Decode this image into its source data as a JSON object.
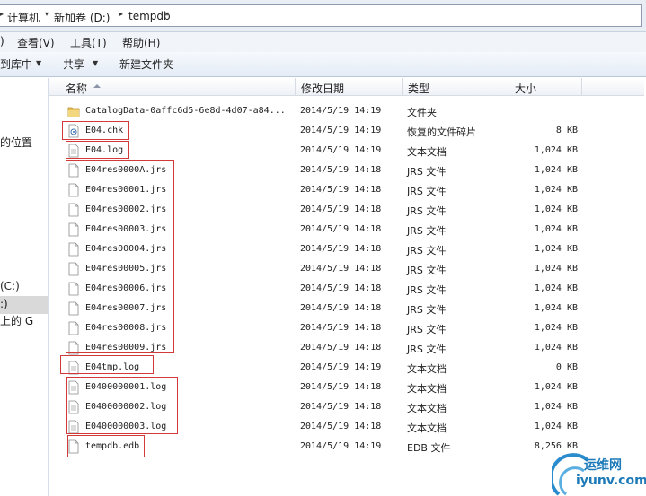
{
  "address": {
    "crumbs": [
      "计算机",
      "新加卷 (D:)",
      "tempdb"
    ]
  },
  "menubar": {
    "items": [
      "查看(V)",
      "工具(T)",
      "帮助(H)"
    ],
    "partial_left": ")"
  },
  "toolbar": {
    "library": "到库中",
    "share": "共享",
    "new_folder": "新建文件夹"
  },
  "nav": {
    "items": [
      "的位置",
      "(C:)",
      ":)",
      "上的 G"
    ]
  },
  "columns": {
    "name": "名称",
    "date": "修改日期",
    "type": "类型",
    "size": "大小"
  },
  "files": [
    {
      "name": "CatalogData-0affc6d5-6e8d-4d07-a84...",
      "date": "2014/5/19 14:19",
      "type": "文件夹",
      "size": "",
      "icon": "folder-icon"
    },
    {
      "name": "E04.chk",
      "date": "2014/5/19 14:19",
      "type": "恢复的文件碎片",
      "size": "8 KB",
      "icon": "chk-file-icon"
    },
    {
      "name": "E04.log",
      "date": "2014/5/19 14:19",
      "type": "文本文档",
      "size": "1,024 KB",
      "icon": "text-file-icon"
    },
    {
      "name": "E04res0000A.jrs",
      "date": "2014/5/19 14:18",
      "type": "JRS 文件",
      "size": "1,024 KB",
      "icon": "file-icon"
    },
    {
      "name": "E04res00001.jrs",
      "date": "2014/5/19 14:18",
      "type": "JRS 文件",
      "size": "1,024 KB",
      "icon": "file-icon"
    },
    {
      "name": "E04res00002.jrs",
      "date": "2014/5/19 14:18",
      "type": "JRS 文件",
      "size": "1,024 KB",
      "icon": "file-icon"
    },
    {
      "name": "E04res00003.jrs",
      "date": "2014/5/19 14:18",
      "type": "JRS 文件",
      "size": "1,024 KB",
      "icon": "file-icon"
    },
    {
      "name": "E04res00004.jrs",
      "date": "2014/5/19 14:18",
      "type": "JRS 文件",
      "size": "1,024 KB",
      "icon": "file-icon"
    },
    {
      "name": "E04res00005.jrs",
      "date": "2014/5/19 14:18",
      "type": "JRS 文件",
      "size": "1,024 KB",
      "icon": "file-icon"
    },
    {
      "name": "E04res00006.jrs",
      "date": "2014/5/19 14:18",
      "type": "JRS 文件",
      "size": "1,024 KB",
      "icon": "file-icon"
    },
    {
      "name": "E04res00007.jrs",
      "date": "2014/5/19 14:18",
      "type": "JRS 文件",
      "size": "1,024 KB",
      "icon": "file-icon"
    },
    {
      "name": "E04res00008.jrs",
      "date": "2014/5/19 14:18",
      "type": "JRS 文件",
      "size": "1,024 KB",
      "icon": "file-icon"
    },
    {
      "name": "E04res00009.jrs",
      "date": "2014/5/19 14:18",
      "type": "JRS 文件",
      "size": "1,024 KB",
      "icon": "file-icon"
    },
    {
      "name": "E04tmp.log",
      "date": "2014/5/19 14:19",
      "type": "文本文档",
      "size": "0 KB",
      "icon": "text-file-icon"
    },
    {
      "name": "E0400000001.log",
      "date": "2014/5/19 14:18",
      "type": "文本文档",
      "size": "1,024 KB",
      "icon": "text-file-icon"
    },
    {
      "name": "E0400000002.log",
      "date": "2014/5/19 14:18",
      "type": "文本文档",
      "size": "1,024 KB",
      "icon": "text-file-icon"
    },
    {
      "name": "E0400000003.log",
      "date": "2014/5/19 14:18",
      "type": "文本文档",
      "size": "1,024 KB",
      "icon": "text-file-icon"
    },
    {
      "name": "tempdb.edb",
      "date": "2014/5/19 14:19",
      "type": "EDB 文件",
      "size": "8,256 KB",
      "icon": "file-icon"
    }
  ],
  "watermark": {
    "line1": "运维网",
    "line2": "iyunv.com"
  },
  "colors": {
    "highlight_box": "#d23a3a",
    "folder": "#e8c05a"
  }
}
